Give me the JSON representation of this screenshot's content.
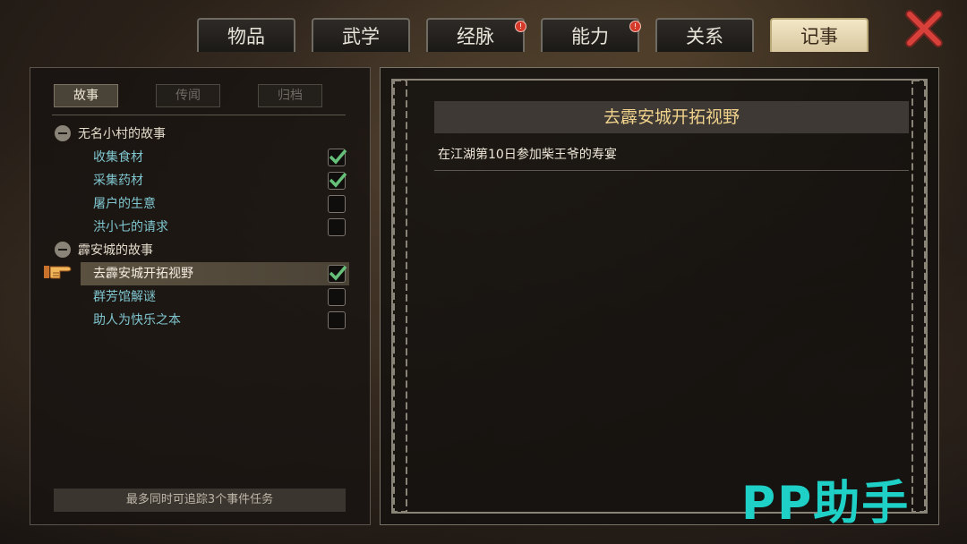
{
  "tabs": [
    {
      "label": "物品",
      "badge": false
    },
    {
      "label": "武学",
      "badge": false
    },
    {
      "label": "经脉",
      "badge": true
    },
    {
      "label": "能力",
      "badge": true
    },
    {
      "label": "关系",
      "badge": false
    },
    {
      "label": "记事",
      "badge": false,
      "active": true
    }
  ],
  "subtabs": [
    {
      "label": "故事",
      "active": true
    },
    {
      "label": "传闻",
      "active": false
    },
    {
      "label": "归档",
      "active": false
    }
  ],
  "tree": {
    "groups": [
      {
        "title": "无名小村的故事",
        "quests": [
          {
            "label": "收集食材",
            "done": true
          },
          {
            "label": "采集药材",
            "done": true
          },
          {
            "label": "屠户的生意",
            "done": false
          },
          {
            "label": "洪小七的请求",
            "done": false
          }
        ]
      },
      {
        "title": "霹安城的故事",
        "quests": [
          {
            "label": "去霹安城开拓视野",
            "done": true,
            "selected": true
          },
          {
            "label": "群芳馆解谜",
            "done": false
          },
          {
            "label": "助人为快乐之本",
            "done": false
          }
        ]
      }
    ]
  },
  "footer_note": "最多同时可追踪3个事件任务",
  "detail": {
    "title": "去霹安城开拓视野",
    "description": "在江湖第10日参加柴王爷的寿宴"
  },
  "watermark": "PP助手",
  "colors": {
    "accent": "#f0d28c",
    "quest_text": "#7fc6cf",
    "check": "#66c07a",
    "badge": "#d33a2a",
    "close": "#d8413a",
    "watermark": "#1fd0c7"
  }
}
